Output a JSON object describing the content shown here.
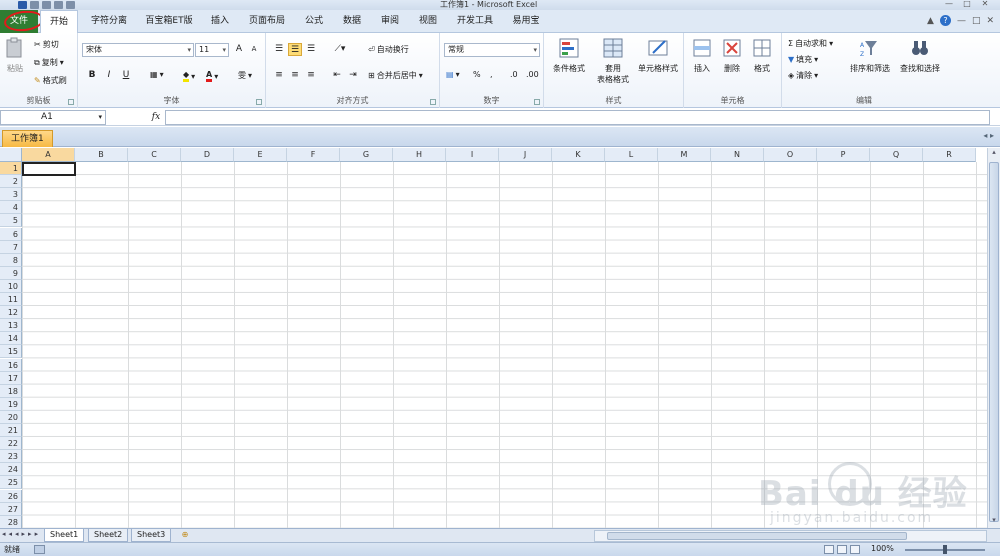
{
  "window": {
    "title": "工作簿1 - Microsoft Excel",
    "controls": [
      "—",
      "□",
      "✕"
    ]
  },
  "tabs": {
    "file": "文件",
    "items": [
      "开始",
      "字符分离",
      "百宝箱ET版",
      "插入",
      "页面布局",
      "公式",
      "数据",
      "审阅",
      "视图",
      "开发工具",
      "易用宝"
    ],
    "active": "开始"
  },
  "ribbon": {
    "clipboard": {
      "label": "剪贴板",
      "paste": "粘贴",
      "cut": "剪切",
      "copy": "复制",
      "format_painter": "格式刷"
    },
    "font": {
      "label": "字体",
      "font_name": "宋体",
      "font_size": "11",
      "bold": "B",
      "italic": "I",
      "underline": "U",
      "font_color_glyph": "A",
      "phonetic_glyph": "雯",
      "grow_glyph": "A",
      "shrink_glyph": "A"
    },
    "alignment": {
      "label": "对齐方式",
      "wrap": "自动换行",
      "merge": "合并后居中"
    },
    "number": {
      "label": "数字",
      "format": "常规",
      "percent": "%",
      "comma": ","
    },
    "styles": {
      "label": "样式",
      "conditional": "条件格式",
      "table_line1": "套用",
      "table_line2": "表格格式",
      "cell_styles": "单元格样式"
    },
    "cells": {
      "label": "单元格",
      "insert": "插入",
      "delete": "删除",
      "format": "格式"
    },
    "editing": {
      "label": "编辑",
      "autosum": "自动求和",
      "fill": "填充",
      "clear": "清除",
      "sort_filter": "排序和筛选",
      "find_select": "查找和选择"
    }
  },
  "formula_bar": {
    "name_box": "A1",
    "fx": "fx",
    "value": ""
  },
  "workbook_tab": "工作簿1",
  "grid": {
    "columns": [
      "A",
      "B",
      "C",
      "D",
      "E",
      "F",
      "G",
      "H",
      "I",
      "J",
      "K",
      "L",
      "M",
      "N",
      "O",
      "P",
      "Q",
      "R"
    ],
    "rows": [
      "1",
      "2",
      "3",
      "4",
      "5",
      "6",
      "7",
      "8",
      "9",
      "10",
      "11",
      "12",
      "13",
      "14",
      "15",
      "16",
      "17",
      "18",
      "19",
      "20",
      "21",
      "22",
      "23",
      "24",
      "25",
      "26",
      "27",
      "28"
    ],
    "selected_cell": "A1"
  },
  "sheets": [
    "Sheet1",
    "Sheet2",
    "Sheet3"
  ],
  "status": {
    "mode": "就绪",
    "zoom": "100%"
  },
  "watermark": {
    "logo": "Bai du 经验",
    "url": "jingyan.baidu.com"
  },
  "colors": {
    "file_tab": "#2f7d32",
    "annotation_circle": "#e21b1b",
    "active_workbook_tab": "#f7b944",
    "selected_header": "#f9d99f"
  }
}
